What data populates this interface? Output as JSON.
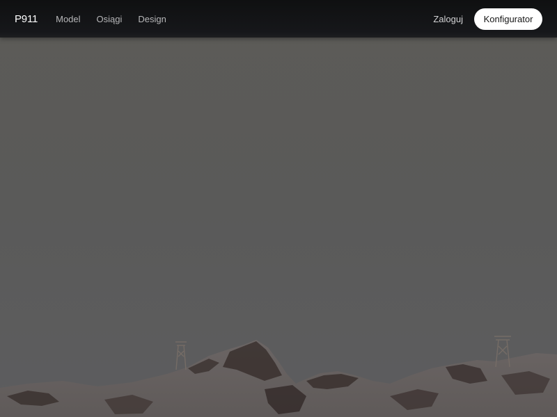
{
  "navbar": {
    "brand": "P911",
    "links": [
      "Model",
      "Osiągi",
      "Design"
    ],
    "login_label": "Zaloguj",
    "cta_label": "Konfigurator"
  },
  "hero": {
    "image_description_icon": "mountain-landscape-image"
  },
  "colors": {
    "navbar_bg": "#131416",
    "hero_overlay": "#5a5a58",
    "cta_bg": "#ffffff",
    "cta_text": "#151515"
  }
}
